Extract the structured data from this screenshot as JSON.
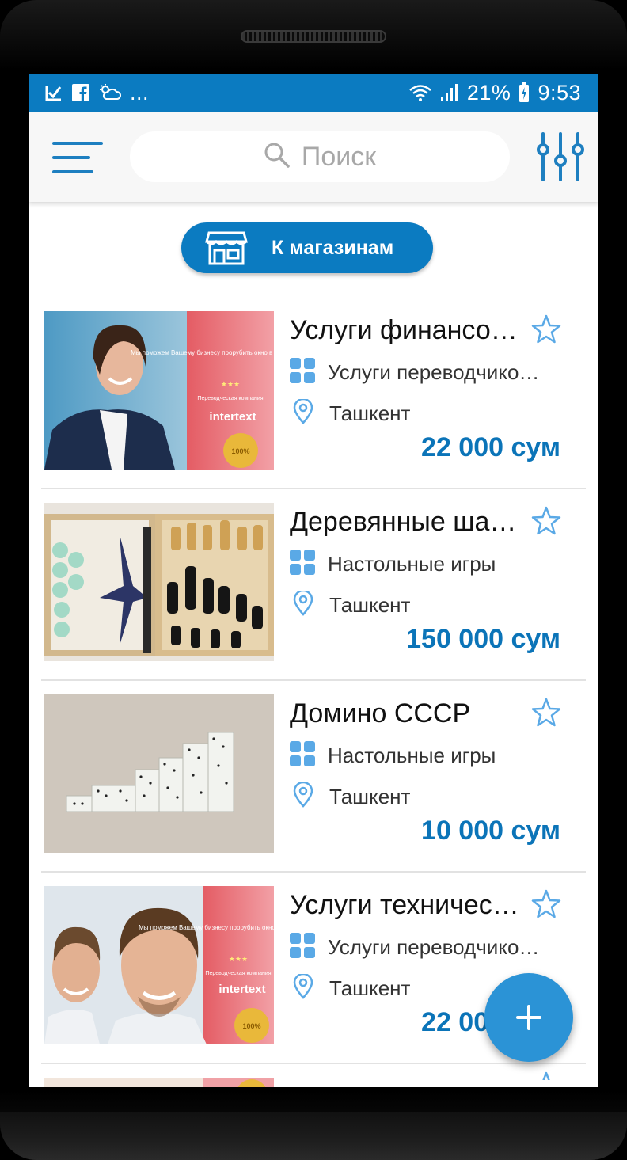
{
  "status_bar": {
    "left_icons": [
      "download-check-icon",
      "facebook-icon",
      "weather-cloud-icon"
    ],
    "more": "...",
    "battery": "21%",
    "time": "9:53"
  },
  "appbar": {
    "search_placeholder": "Поиск"
  },
  "stores_button": {
    "label": "К магазинам"
  },
  "items": [
    {
      "title": "Услуги финансо…",
      "category": "Услуги переводчико…",
      "location": "Ташкент",
      "price": "22 000 сум",
      "image": "woman-translation-ad"
    },
    {
      "title": "Деревянные ша…",
      "category": "Настольные игры",
      "location": "Ташкент",
      "price": "150 000 сум",
      "image": "backgammon-chess-board"
    },
    {
      "title": "Домино СССР",
      "category": "Настольные игры",
      "location": "Ташкент",
      "price": "10 000 сум",
      "image": "domino-tiles"
    },
    {
      "title": "Услуги техничес…",
      "category": "Услуги переводчико…",
      "location": "Ташкент",
      "price": "22 000 сум",
      "image": "men-translation-ad"
    }
  ],
  "ad_text": {
    "promo": "Мы поможем Вашему бизнесу прорубить окно в любую часть света",
    "company": "Переводческая компания",
    "brand": "intertext",
    "stars": "★★★",
    "seal": "100%"
  },
  "colors": {
    "accent": "#0b7bc1",
    "price": "#0b74b8",
    "icon_light": "#5aa9e6",
    "fab": "#2b93d6"
  }
}
